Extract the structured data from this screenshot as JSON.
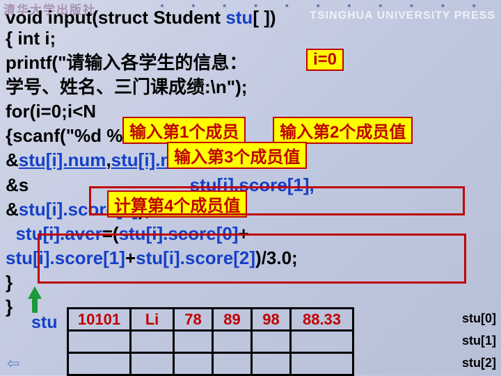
{
  "logo": "清华大学出版社",
  "faded": "TSINGHUA UNIVERSITY PRESS",
  "dots": "● ● ● ● ● ● ● ● ● ● ●",
  "header": {
    "t1": "void input(struct Student ",
    "t2": "stu",
    "t3": "[ ])"
  },
  "code": {
    "l1": "{ int i;",
    "l2a": "  printf(\"请输入各学生的信息：",
    "l3a": "                学号、姓名、三门课成绩:\\n\");",
    "l4a": "  for(i=0;i<N",
    "l5a": "  {scanf(\"%d %s",
    "l6a": "                &",
    "l6b": "stu[i].num",
    "l6c": ",",
    "l6d": "stu[i].name",
    "l6e": ",",
    "l7a": "         &s",
    "l7b": "stu[i].score[1],",
    "l8a": "                &",
    "l8b": "stu[i].score[2]",
    "l8c": ");",
    "l9a": "stu[i].aver",
    "l9b": "=(",
    "l9c": "stu[i].score[0]",
    "l9d": "+",
    "l10a": "         ",
    "l10b": "stu[i].score[1]",
    "l10c": "+",
    "l10d": "stu[i].score[2]",
    "l10e": ")/3.0;",
    "l11": "  }",
    "l12": "}"
  },
  "callouts": {
    "a": "i=0",
    "b": "输入第1个成员",
    "c": "输入第2个成员值",
    "d": "输入第3个成员值",
    "e": "计算第4个成员值"
  },
  "stuLabel": "stu",
  "table": {
    "r0": [
      "10101",
      "Li",
      "78",
      "89",
      "98",
      "88.33"
    ]
  },
  "idx": [
    "stu[0]",
    "stu[1]",
    "stu[2]"
  ],
  "nav": "⇦"
}
